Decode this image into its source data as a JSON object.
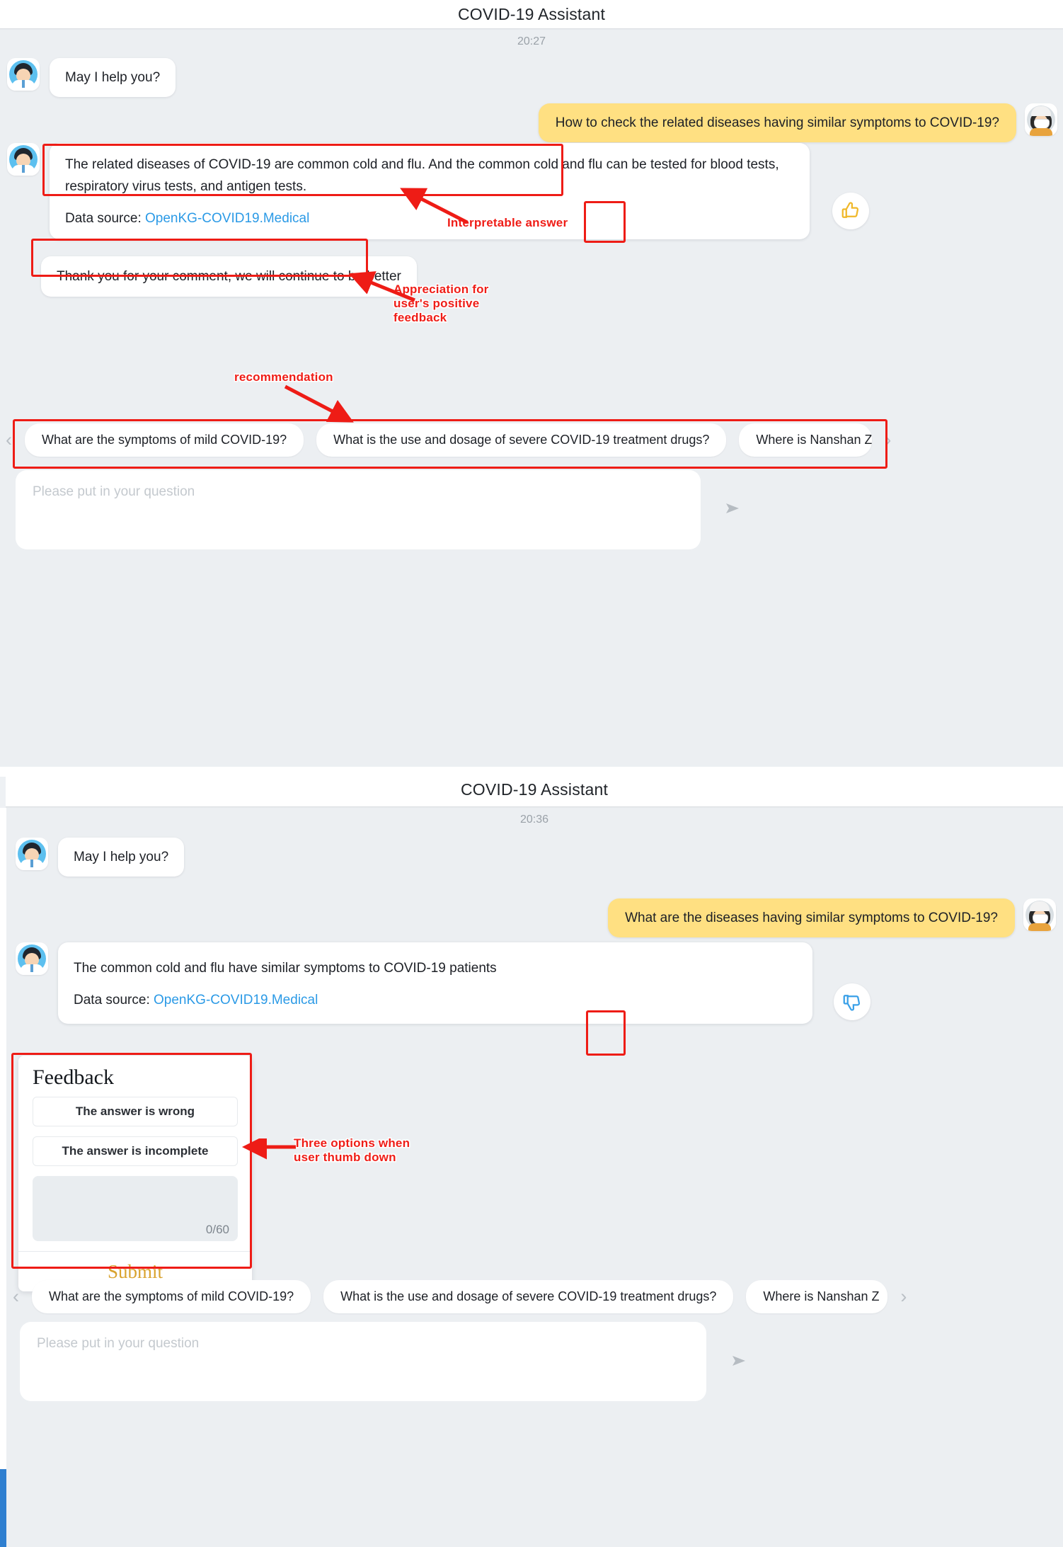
{
  "screen1": {
    "header": {
      "title": "COVID-19 Assistant"
    },
    "timestamp": "20:27",
    "messages": [
      {
        "role": "bot",
        "text": "May I help you?"
      },
      {
        "role": "user",
        "text": "How to check the related diseases having similar symptoms to COVID-19?"
      },
      {
        "role": "bot_answer",
        "text": "The related diseases of COVID-19 are common cold and flu. And the common cold and flu can be tested for blood tests, respiratory virus tests, and antigen tests.",
        "data_source_label": "Data source:",
        "data_source_value": "OpenKG-COVID19.Medical",
        "reaction_icon": "thumbs-up-icon"
      },
      {
        "role": "bot",
        "text": "Thank you for your comment, we will continue to be better"
      }
    ],
    "suggestions": [
      "What are the symptoms of mild COVID-19?",
      "What is the use and dosage of severe COVID-19 treatment drugs?",
      "Where is Nanshan Z"
    ],
    "nav_prev": "‹",
    "nav_next": "›",
    "composer": {
      "placeholder": "Please put in your question",
      "send_icon": "send-icon"
    },
    "annotations": [
      {
        "text": "Interpretable answer"
      },
      {
        "text": "Appreciation for\nuser's positive\nfeedback"
      },
      {
        "text": "recommendation"
      }
    ]
  },
  "screen2": {
    "header": {
      "title": "COVID-19 Assistant"
    },
    "timestamp": "20:36",
    "messages": [
      {
        "role": "bot",
        "text": "May I help you?"
      },
      {
        "role": "user",
        "text": "What are the diseases having similar symptoms to COVID-19?"
      },
      {
        "role": "bot_answer",
        "text": "The common cold and flu have similar symptoms to COVID-19 patients",
        "data_source_label": "Data source:",
        "data_source_value": "OpenKG-COVID19.Medical",
        "reaction_icon": "thumbs-down-icon"
      }
    ],
    "feedback": {
      "title": "Feedback",
      "options": [
        "The answer is wrong",
        "The answer is incomplete"
      ],
      "comment_value": "",
      "counter": "0/60",
      "submit_label": "Submit"
    },
    "suggestions": [
      "What are the symptoms of mild COVID-19?",
      "What is the use and dosage of severe COVID-19 treatment drugs?",
      "Where is Nanshan Z"
    ],
    "nav_prev": "‹",
    "nav_next": "›",
    "composer": {
      "placeholder": "Please put in your question",
      "send_icon": "send-icon"
    },
    "annotations": [
      {
        "text": "Three options when\nuser  thumb down"
      }
    ]
  },
  "colors": {
    "annotation_red": "#ee1c16",
    "user_bubble": "#ffe082",
    "link_blue": "#2b9ae6",
    "submit_gold": "#d9a330",
    "background": "#eceff2"
  }
}
